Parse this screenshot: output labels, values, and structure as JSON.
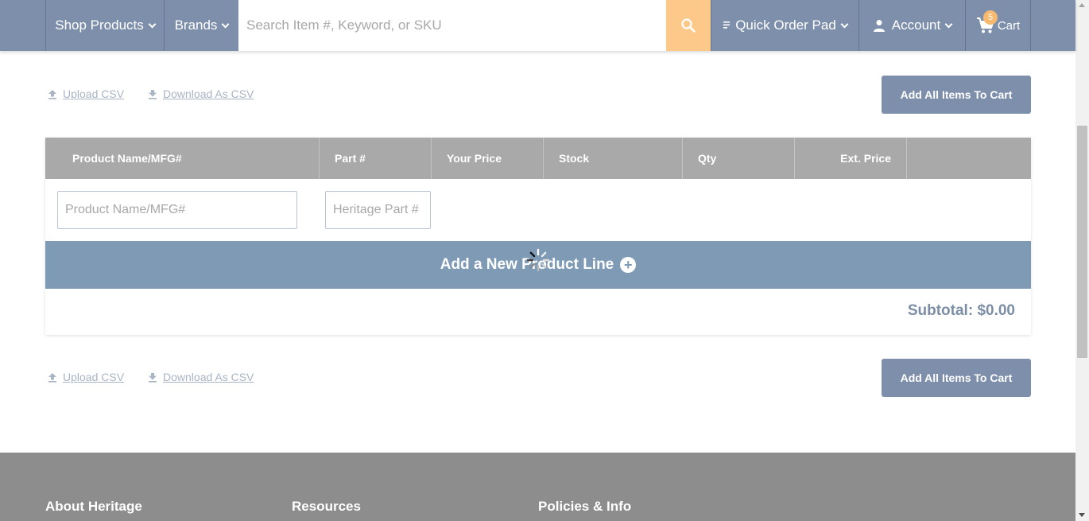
{
  "header": {
    "shop_products": "Shop Products",
    "brands": "Brands",
    "search_placeholder": "Search Item #, Keyword, or SKU",
    "quick_order_pad": "Quick Order Pad",
    "account": "Account",
    "cart_label": "Cart",
    "cart_count": "5"
  },
  "csv_top": {
    "upload": "Upload CSV",
    "download": "Download As CSV",
    "add_all": "Add All Items To Cart"
  },
  "table": {
    "columns": [
      "Product Name/MFG#",
      "Part #",
      "Your Price",
      "Stock",
      "Qty",
      "Ext. Price"
    ],
    "product_placeholder": "Product Name/MFG#",
    "part_placeholder": "Heritage Part #",
    "add_line": "Add a New Product Line",
    "subtotal": "Subtotal: $0.00"
  },
  "csv_bottom": {
    "upload": "Upload CSV",
    "download": "Download As CSV",
    "add_all": "Add All Items To Cart"
  },
  "footer": {
    "col1": "About Heritage",
    "col2": "Resources",
    "col3": "Policies & Info"
  },
  "colors": {
    "header_bg": "#7e8fab",
    "search_button": "#fdc98a",
    "table_header": "#a9a9a9",
    "add_line_bg": "#7e9ab5",
    "footer_bg": "#8d8d8d"
  }
}
